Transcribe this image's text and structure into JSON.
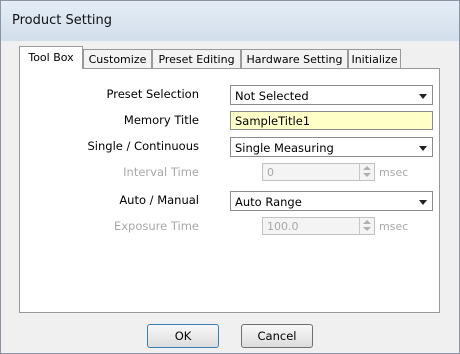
{
  "window": {
    "title": "Product Setting"
  },
  "tabs": [
    {
      "label": "Tool Box",
      "active": true
    },
    {
      "label": "Customize",
      "active": false
    },
    {
      "label": "Preset Editing",
      "active": false
    },
    {
      "label": "Hardware Setting",
      "active": false
    },
    {
      "label": "Initialize",
      "active": false
    }
  ],
  "form": {
    "preset_selection": {
      "label": "Preset Selection",
      "value": "Not Selected"
    },
    "memory_title": {
      "label": "Memory Title",
      "value": "SampleTitle1"
    },
    "single_continuous": {
      "label": "Single / Continuous",
      "value": "Single Measuring"
    },
    "interval_time": {
      "label": "Interval Time",
      "value": "0",
      "unit": "msec",
      "enabled": false
    },
    "auto_manual": {
      "label": "Auto / Manual",
      "value": "Auto Range"
    },
    "exposure_time": {
      "label": "Exposure Time",
      "value": "100.0",
      "unit": "msec",
      "enabled": false
    }
  },
  "buttons": {
    "ok": "OK",
    "cancel": "Cancel"
  },
  "colors": {
    "memory_title_bg": "#ffffc8",
    "titlebar": "#dbe5f1"
  }
}
